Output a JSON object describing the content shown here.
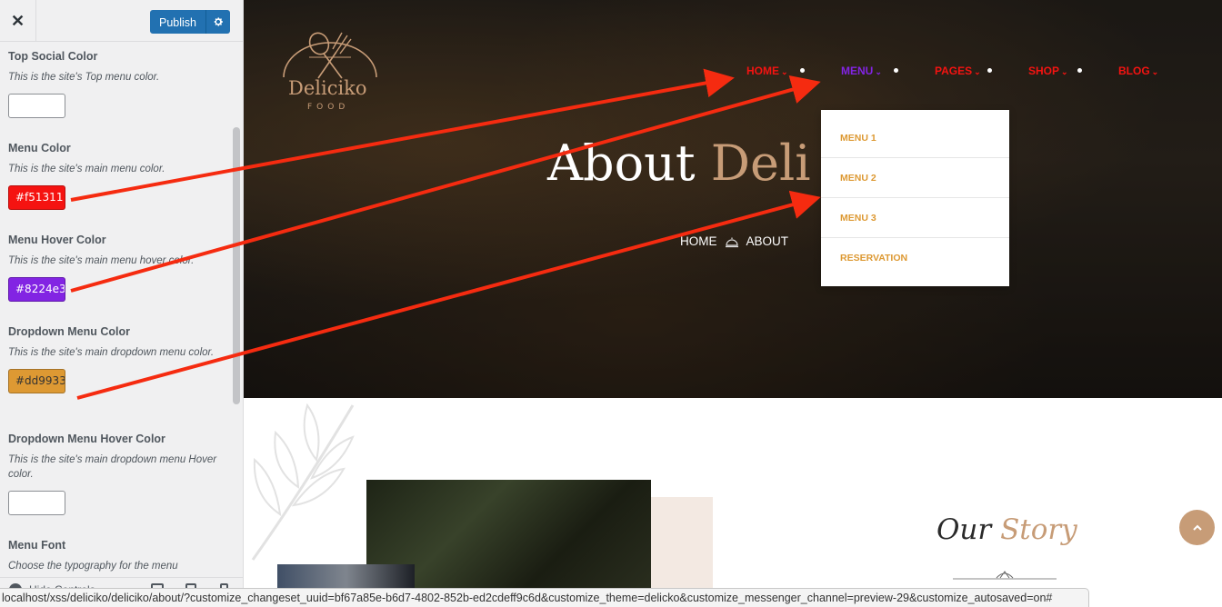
{
  "customizer": {
    "close_label": "✕",
    "publish_label": "Publish",
    "controls": [
      {
        "title": "Top Social Color",
        "description": "This is the site's Top menu color.",
        "value": ""
      },
      {
        "title": "Menu Color",
        "description": "This is the site's main menu color.",
        "value": "#f51311"
      },
      {
        "title": "Menu Hover Color",
        "description": "This is the site's main menu hover color.",
        "value": "#8224e3"
      },
      {
        "title": "Dropdown Menu Color",
        "description": "This is the site's main dropdown menu color.",
        "value": "#dd9933"
      },
      {
        "title": "Dropdown Menu Hover Color",
        "description": "This is the site's main dropdown menu Hover color.",
        "value": ""
      },
      {
        "title": "Menu Font",
        "description": "Choose the typography for the menu"
      }
    ],
    "footer": {
      "hide_controls_label": "Hide Controls"
    }
  },
  "site": {
    "logo": {
      "name": "Deliciko",
      "sub": "FOOD"
    },
    "nav": [
      {
        "label": "HOME"
      },
      {
        "label": "MENU"
      },
      {
        "label": "PAGES"
      },
      {
        "label": "SHOP"
      },
      {
        "label": "BLOG"
      }
    ],
    "dropdown": [
      "MENU 1",
      "MENU 2",
      "MENU 3",
      "RESERVATION"
    ],
    "hero_title": {
      "main": "About",
      "accent": "Deli"
    },
    "breadcrumb": {
      "home": "HOME",
      "current": "ABOUT"
    },
    "story": {
      "word1": "Our",
      "word2": "Story"
    }
  },
  "colors": {
    "menu": "#f51311",
    "menu_hover": "#8224e3",
    "dropdown": "#dd9933",
    "accent": "#c79c77",
    "arrow": "#f52b10",
    "wp_blue": "#2271b1"
  },
  "statusbar": {
    "url": "localhost/xss/deliciko/deliciko/about/?customize_changeset_uuid=bf67a85e-b6d7-4802-852b-ed2cdeff9c6d&customize_theme=delicko&customize_messenger_channel=preview-29&customize_autosaved=on#"
  }
}
